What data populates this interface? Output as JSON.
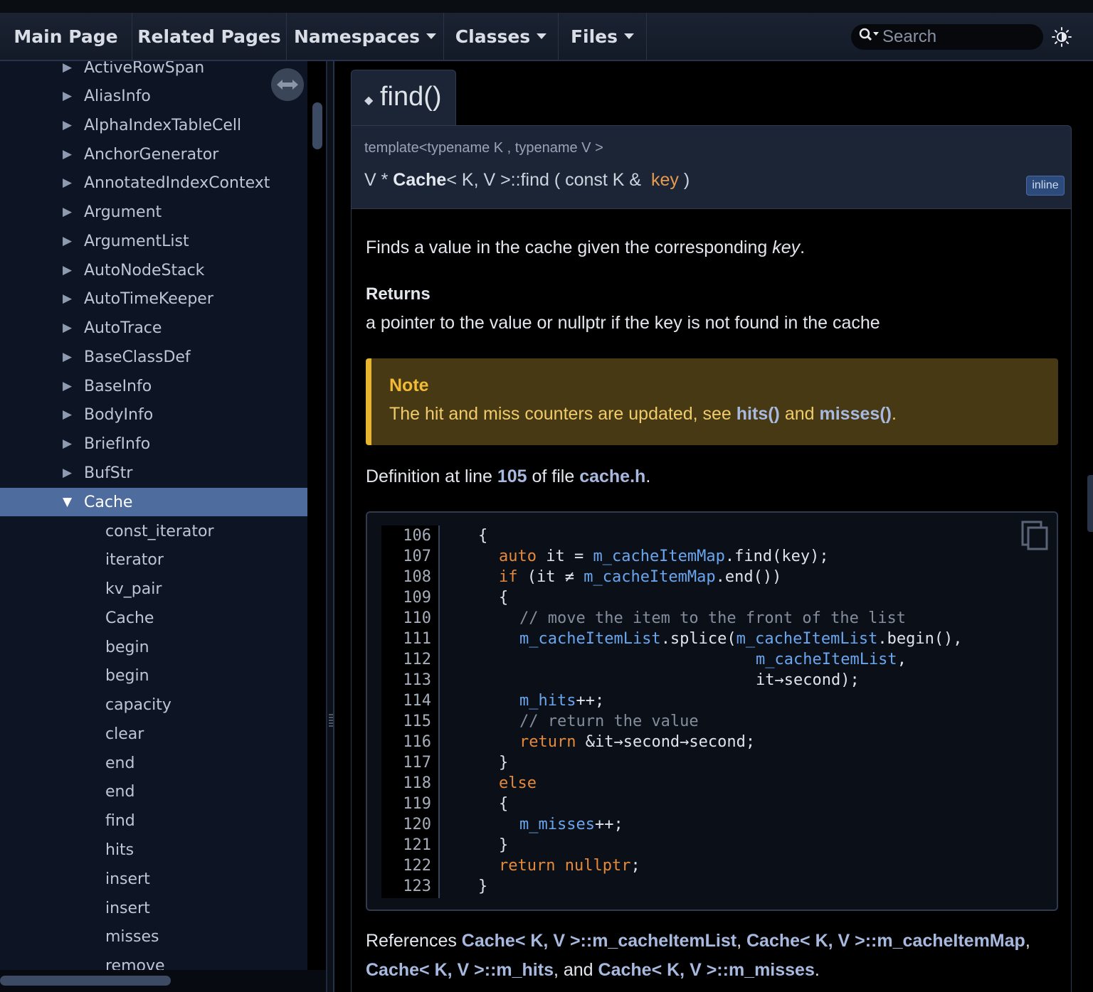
{
  "navbar": {
    "tabs": [
      {
        "label": "Main Page",
        "dropdown": false
      },
      {
        "label": "Related Pages",
        "dropdown": false
      },
      {
        "label": "Namespaces",
        "dropdown": true
      },
      {
        "label": "Classes",
        "dropdown": true
      },
      {
        "label": "Files",
        "dropdown": true
      }
    ],
    "search": {
      "placeholder": "Search",
      "icon": "search-icon"
    },
    "theme_toggle_icon": "sun-icon"
  },
  "sidebar": {
    "items": [
      {
        "label": "ActiveRowSpan",
        "expandable": true
      },
      {
        "label": "AliasInfo",
        "expandable": true
      },
      {
        "label": "AlphaIndexTableCell",
        "expandable": true
      },
      {
        "label": "AnchorGenerator",
        "expandable": true
      },
      {
        "label": "AnnotatedIndexContext",
        "expandable": true
      },
      {
        "label": "Argument",
        "expandable": true
      },
      {
        "label": "ArgumentList",
        "expandable": true
      },
      {
        "label": "AutoNodeStack",
        "expandable": true
      },
      {
        "label": "AutoTimeKeeper",
        "expandable": true
      },
      {
        "label": "AutoTrace",
        "expandable": true
      },
      {
        "label": "BaseClassDef",
        "expandable": true
      },
      {
        "label": "BaseInfo",
        "expandable": true
      },
      {
        "label": "BodyInfo",
        "expandable": true
      },
      {
        "label": "BriefInfo",
        "expandable": true
      },
      {
        "label": "BufStr",
        "expandable": true
      },
      {
        "label": "Cache",
        "expandable": true,
        "expanded": true,
        "selected": true
      }
    ],
    "children": [
      "const_iterator",
      "iterator",
      "kv_pair",
      "Cache",
      "begin",
      "begin",
      "capacity",
      "clear",
      "end",
      "end",
      "find",
      "hits",
      "insert",
      "insert",
      "misses",
      "remove"
    ],
    "expand_arrow": "▶",
    "collapse_arrow": "▼"
  },
  "member": {
    "name": "find()",
    "bullet": "◆",
    "template": "template<typename K , typename V >",
    "signature": {
      "ret": "V * ",
      "cls": "Cache",
      "rest": "< K, V >::find ( const K &  ",
      "param": "key",
      "close": " )"
    },
    "badge": "inline",
    "brief_pre": "Finds a value in the cache given the corresponding ",
    "brief_em": "key",
    "brief_post": ".",
    "returns_title": "Returns",
    "returns_text": "a pointer to the value or nullptr if the key is not found in the cache",
    "note_title": "Note",
    "note_pre": "The hit and miss counters are updated, see ",
    "note_link1": "hits()",
    "note_mid": " and ",
    "note_link2": "misses()",
    "note_post": ".",
    "def_pre": "Definition at line ",
    "def_line": "105",
    "def_mid": " of file ",
    "def_file": "cache.h",
    "def_post": ".",
    "refs_pre": "References ",
    "ref1": "Cache< K, V >::m_cacheItemList",
    "ref_sep": ", ",
    "ref2": "Cache< K, V >::m_cacheItemMap",
    "ref_sep2": ",",
    "ref3": "Cache< K, V >::m_hits",
    "ref_and": ", and ",
    "ref4": "Cache< K, V >::m_misses",
    "refs_post": "."
  },
  "code": {
    "copy_icon": "copy-icon",
    "line_numbers": [
      "106",
      "107",
      "108",
      "109",
      "110",
      "111",
      "112",
      "113",
      "114",
      "115",
      "116",
      "117",
      "118",
      "119",
      "120",
      "121",
      "122",
      "123"
    ],
    "l106": "{",
    "l107_kw": "auto",
    "l107_a": " it = ",
    "l107_var": "m_cacheItemMap",
    "l107_b": ".find(key);",
    "l108_kw": "if",
    "l108_a": " (it ≠ ",
    "l108_var": "m_cacheItemMap",
    "l108_b": ".end())",
    "l109": "{",
    "l110": "// move the item to the front of the list",
    "l111_var": "m_cacheItemList",
    "l111_a": ".splice(",
    "l111_var2": "m_cacheItemList",
    "l111_b": ".begin(),",
    "l112_var": "m_cacheItemList",
    "l112_b": ",",
    "l113": "it→second);",
    "l114_var": "m_hits",
    "l114_b": "++;",
    "l115": "// return the value",
    "l116_kw": "return",
    "l116_b": " &it→second→second;",
    "l117": "}",
    "l118_kw": "else",
    "l119": "{",
    "l120_var": "m_misses",
    "l120_b": "++;",
    "l121": "}",
    "l122_kw": "return",
    "l122_kw2": "nullptr",
    "l122_b": ";",
    "l123": "}"
  }
}
